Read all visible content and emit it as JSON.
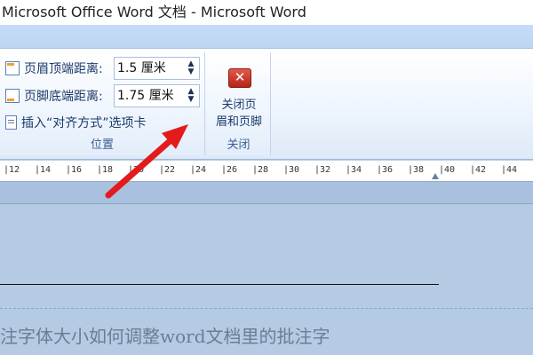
{
  "window": {
    "title": "Microsoft Office Word 文档 - Microsoft Word"
  },
  "ribbon": {
    "position_group": {
      "label": "位置",
      "header_row": {
        "label": "页眉顶端距离:",
        "value": "1.5 厘米"
      },
      "footer_row": {
        "label": "页脚底端距离:",
        "value": "1.75 厘米"
      },
      "insert_tab": {
        "label": "插入“对齐方式”选项卡"
      }
    },
    "close_group": {
      "label": "关闭",
      "close_button_line1": "关闭页",
      "close_button_line2": "眉和页脚"
    }
  },
  "ruler": {
    "ticks": [
      "12",
      "14",
      "16",
      "18",
      "20",
      "22",
      "24",
      "26",
      "28",
      "30",
      "32",
      "34",
      "36",
      "38",
      "40",
      "42",
      "44"
    ]
  },
  "document": {
    "body_text": "注字体大小如何调整word文档里的批注字"
  },
  "colors": {
    "arrow": "#e31b1b",
    "ribbon_text": "#1c3a6b",
    "page_bg": "#b5cbe4"
  }
}
